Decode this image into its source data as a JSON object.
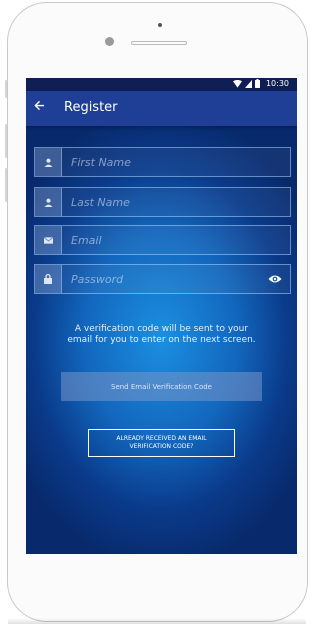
{
  "status_bar": {
    "time": "10:30"
  },
  "app_bar": {
    "back_icon": "arrow-left-icon",
    "title": "Register"
  },
  "form": {
    "first_name": {
      "icon": "person-icon",
      "placeholder": "First Name",
      "value": ""
    },
    "last_name": {
      "icon": "person-icon",
      "placeholder": "Last Name",
      "value": ""
    },
    "email": {
      "icon": "envelope-icon",
      "placeholder": "Email",
      "value": ""
    },
    "password": {
      "icon": "lock-icon",
      "placeholder": "Password",
      "value": "",
      "toggle_icon": "eye-icon"
    }
  },
  "info_text": "A verification code will be sent to your email for you to enter on the next screen.",
  "buttons": {
    "send_code": "Send Email Verification Code",
    "already_received": "ALREADY RECEIVED AN EMAIL VERIFICATION CODE?"
  },
  "colors": {
    "status_bar": "#0f1f55",
    "app_bar": "#1f3f96",
    "screen_center": "#1c8fe0",
    "screen_edge": "#082a6c"
  }
}
